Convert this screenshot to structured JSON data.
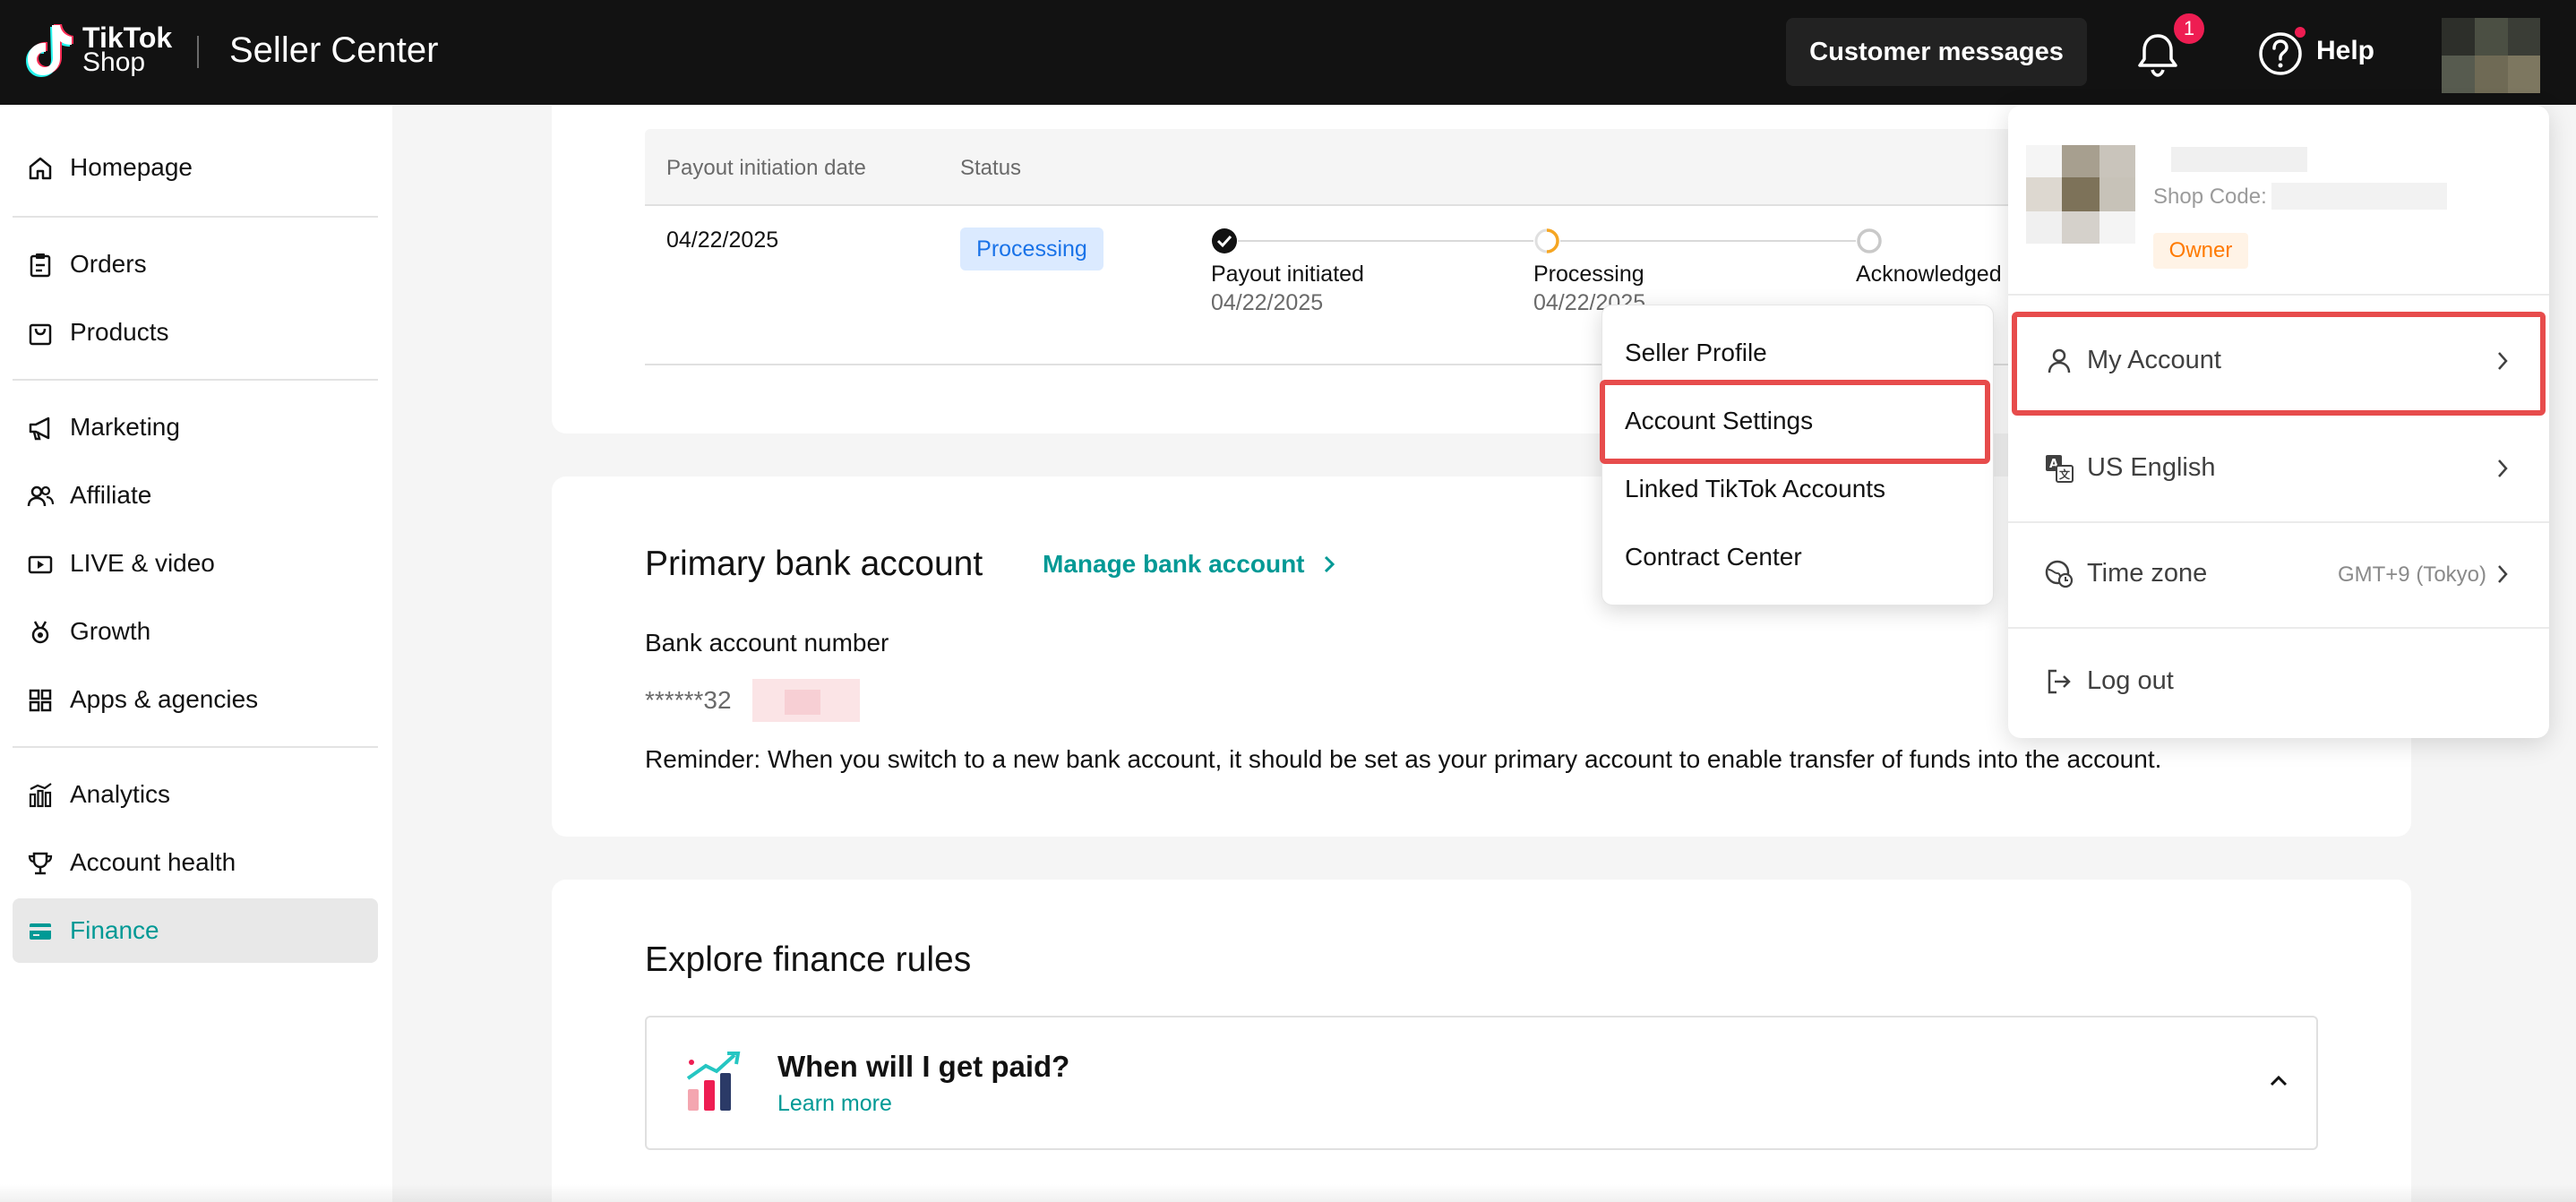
{
  "header": {
    "logo_line1": "TikTok",
    "logo_line2": "Shop",
    "title": "Seller Center",
    "customer_messages": "Customer messages",
    "notification_count": "1",
    "help": "Help"
  },
  "sidebar": {
    "items": [
      {
        "label": "Homepage",
        "icon": "home-icon"
      },
      {
        "label": "Orders",
        "icon": "clipboard-icon"
      },
      {
        "label": "Products",
        "icon": "bag-icon"
      },
      {
        "label": "Marketing",
        "icon": "megaphone-icon"
      },
      {
        "label": "Affiliate",
        "icon": "people-icon"
      },
      {
        "label": "LIVE & video",
        "icon": "video-icon"
      },
      {
        "label": "Growth",
        "icon": "medal-icon"
      },
      {
        "label": "Apps & agencies",
        "icon": "grid-icon"
      },
      {
        "label": "Analytics",
        "icon": "bar-chart-icon"
      },
      {
        "label": "Account health",
        "icon": "trophy-icon"
      },
      {
        "label": "Finance",
        "icon": "card-icon",
        "active": true
      }
    ]
  },
  "payout_table": {
    "col_date": "Payout initiation date",
    "col_status": "Status",
    "row_date": "04/22/2025",
    "status": "Processing",
    "steps": [
      {
        "label": "Payout initiated",
        "date": "04/22/2025",
        "state": "done"
      },
      {
        "label": "Processing",
        "date": "04/22/2025",
        "state": "current"
      },
      {
        "label": "Acknowledged",
        "date": "",
        "state": "pending"
      }
    ]
  },
  "bank": {
    "title": "Primary bank account",
    "manage_link": "Manage bank account",
    "account_label": "Bank account number",
    "account_number": "******32",
    "reminder": "Reminder: When you switch to a new bank account, it should be set as your primary account to enable transfer of funds into the account."
  },
  "finance_rules": {
    "title": "Explore finance rules",
    "question": "When will I get paid?",
    "learn_more": "Learn more"
  },
  "submenu": {
    "items": [
      "Seller Profile",
      "Account Settings",
      "Linked TikTok Accounts",
      "Contract Center"
    ],
    "highlighted": "Account Settings"
  },
  "account_menu": {
    "shop_code_label": "Shop Code:",
    "role": "Owner",
    "my_account": "My Account",
    "language": "US English",
    "time_zone_label": "Time zone",
    "time_zone_value": "GMT+9 (Tokyo)",
    "log_out": "Log out"
  },
  "colors": {
    "accent": "#009995",
    "highlight": "#e74c4c",
    "topbar": "#121212",
    "owner": "#ff7a00",
    "processing_pill": "#dbeaff"
  }
}
